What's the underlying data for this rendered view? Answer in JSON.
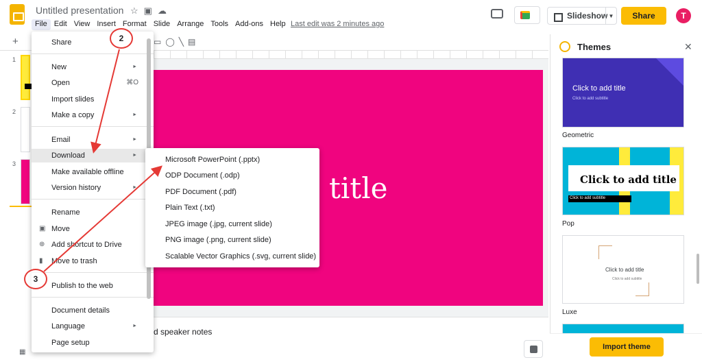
{
  "app": {
    "title": "Untitled presentation",
    "menus": [
      "File",
      "Edit",
      "View",
      "Insert",
      "Format",
      "Slide",
      "Arrange",
      "Tools",
      "Add-ons",
      "Help"
    ],
    "active_menu": "File",
    "last_edit": "Last edit was 2 minutes ago",
    "slideshow_label": "Slideshow",
    "share_label": "Share",
    "avatar_letter": "T",
    "accent": "#fbbc04"
  },
  "slides_panel": {
    "numbers": [
      "1",
      "2",
      "3"
    ]
  },
  "canvas": {
    "slide_title": "title",
    "slide_color": "#f0047f",
    "speaker_notes": "d speaker notes"
  },
  "file_menu": {
    "items": [
      {
        "label": "Share"
      },
      {
        "label": "New",
        "arrow": "►"
      },
      {
        "label": "Open",
        "shortcut": "⌘O"
      },
      {
        "label": "Import slides"
      },
      {
        "label": "Make a copy",
        "arrow": "►"
      },
      {
        "label": "Email",
        "arrow": "►"
      },
      {
        "label": "Download",
        "arrow": "►"
      },
      {
        "label": "Make available offline"
      },
      {
        "label": "Version history",
        "arrow": "►"
      },
      {
        "label": "Rename"
      },
      {
        "label": "Move"
      },
      {
        "label": "Add shortcut to Drive"
      },
      {
        "label": "Move to trash"
      },
      {
        "label": "Publish to the web"
      },
      {
        "label": "Document details"
      },
      {
        "label": "Language",
        "arrow": "►"
      },
      {
        "label": "Page setup"
      }
    ]
  },
  "download_submenu": {
    "items": [
      "Microsoft PowerPoint (.pptx)",
      "ODP Document (.odp)",
      "PDF Document (.pdf)",
      "Plain Text (.txt)",
      "JPEG image (.jpg, current slide)",
      "PNG image (.png, current slide)",
      "Scalable Vector Graphics (.svg, current slide)"
    ]
  },
  "themes_panel": {
    "title": "Themes",
    "themes": [
      {
        "name": "Geometric",
        "title": "Click to add title",
        "subtitle": "Click to add subtitle"
      },
      {
        "name": "Pop",
        "title": "Click to add title",
        "subtitle": "Click to add subtitle"
      },
      {
        "name": "Luxe",
        "title": "Click to add title",
        "subtitle": "Click to add subtitle"
      }
    ],
    "import_label": "Import theme"
  },
  "annotations": {
    "step2": "2",
    "step3": "3",
    "color": "#e53935"
  }
}
